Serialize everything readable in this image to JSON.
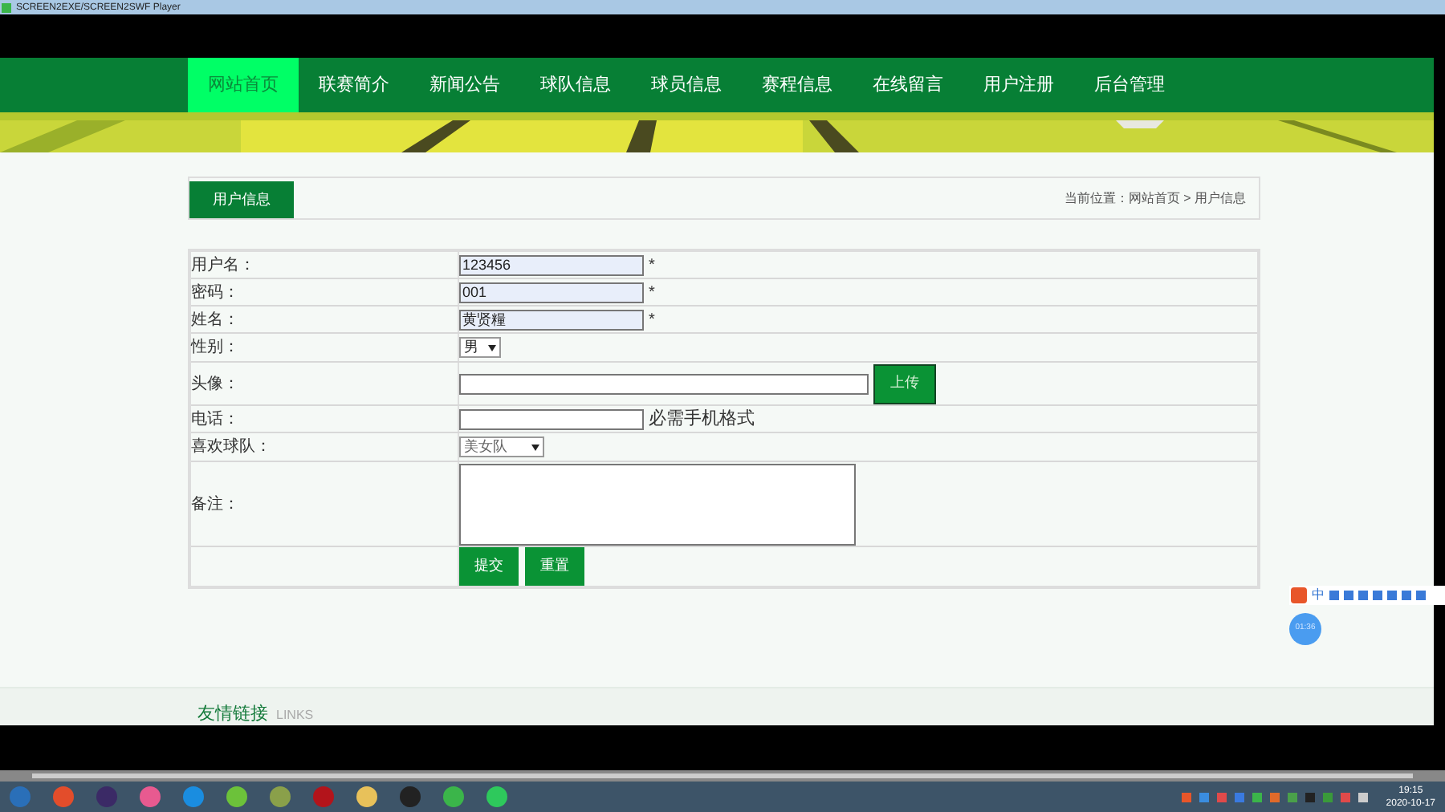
{
  "window": {
    "title": "SCREEN2EXE/SCREEN2SWF Player"
  },
  "nav": [
    {
      "label": "网站首页",
      "selected": true
    },
    {
      "label": "联赛简介",
      "selected": false
    },
    {
      "label": "新闻公告",
      "selected": false
    },
    {
      "label": "球队信息",
      "selected": false
    },
    {
      "label": "球员信息",
      "selected": false
    },
    {
      "label": "赛程信息",
      "selected": false
    },
    {
      "label": "在线留言",
      "selected": false
    },
    {
      "label": "用户注册",
      "selected": false
    },
    {
      "label": "后台管理",
      "selected": false
    }
  ],
  "section_tab": "用户信息",
  "breadcrumb": "当前位置：网站首页 > 用户信息",
  "form": {
    "rows": [
      {
        "kind": "text",
        "label": "用户名：",
        "value": "123456",
        "autofilled": true,
        "mark": "*"
      },
      {
        "kind": "text",
        "label": "密码：",
        "value": "001",
        "autofilled": true,
        "mark": "*"
      },
      {
        "kind": "text",
        "label": "姓名：",
        "value": "黄贤糧",
        "autofilled": true,
        "mark": "*"
      },
      {
        "kind": "select",
        "label": "性别：",
        "value": "男",
        "greyed": false
      },
      {
        "kind": "file",
        "label": "头像：",
        "button": "上传"
      },
      {
        "kind": "text",
        "label": "电话：",
        "autofilled": false,
        "hint": "必需手机格式"
      },
      {
        "kind": "select",
        "label": "喜欢球队：",
        "value": "美女队",
        "greyed": true
      },
      {
        "kind": "textarea",
        "label": "备注："
      }
    ],
    "buttons": [
      "提交",
      "重置"
    ]
  },
  "footer": {
    "title": "友情链接",
    "subtitle": "LINKS"
  },
  "ime_toolbar": {
    "label": "中"
  },
  "timer": "01:36",
  "taskbar": {
    "time": "19:15",
    "date": "2020-10-17"
  }
}
